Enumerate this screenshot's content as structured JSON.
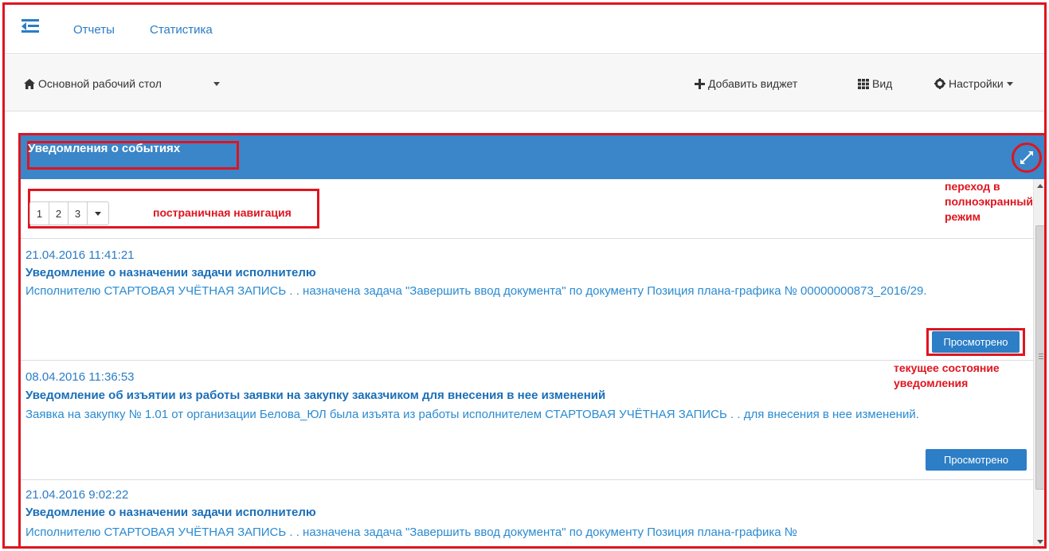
{
  "nav": {
    "links": [
      "Отчеты",
      "Статистика"
    ]
  },
  "toolbar": {
    "desktop_label": "Основной рабочий стол",
    "add_widget_label": "Добавить виджет",
    "view_label": "Вид",
    "settings_label": "Настройки"
  },
  "widget": {
    "title": "Уведомления о событиях"
  },
  "pager": {
    "pages": [
      "1",
      "2",
      "3"
    ]
  },
  "annotations": {
    "pagination": "постраничная навигация",
    "fullscreen": "переход в полноэкранный режим",
    "state": "текущее состояние уведомления"
  },
  "notifications": [
    {
      "date": "21.04.2016 11:41:21",
      "title": "Уведомление о назначении задачи исполнителю",
      "body": "Исполнителю СТАРТОВАЯ УЧЁТНАЯ ЗАПИСЬ . . назначена задача \"Завершить ввод документа\" по документу Позиция плана-графика № 00000000873_2016/29.",
      "button": "Просмотрено"
    },
    {
      "date": "08.04.2016 11:36:53",
      "title": "Уведомление об изъятии из работы заявки на закупку заказчиком для внесения в нее изменений",
      "body": "Заявка на закупку № 1.01 от организации Белова_ЮЛ была изъята из работы исполнителем СТАРТОВАЯ УЧЁТНАЯ ЗАПИСЬ . . для внесения в нее изменений.",
      "button": "Просмотрено"
    },
    {
      "date": "21.04.2016 9:02:22",
      "title": "Уведомление о назначении задачи исполнителю",
      "body": "Исполнителю СТАРТОВАЯ УЧЁТНАЯ ЗАПИСЬ . . назначена задача \"Завершить ввод документа\" по документу Позиция плана-графика №"
    }
  ],
  "colors": {
    "accent": "#2a7cc7",
    "header": "#3a86c8",
    "annotation": "#e0141e"
  },
  "icons": [
    "menu-icon",
    "home-icon",
    "plus-icon",
    "grid-icon",
    "gear-icon",
    "expand-icon"
  ]
}
